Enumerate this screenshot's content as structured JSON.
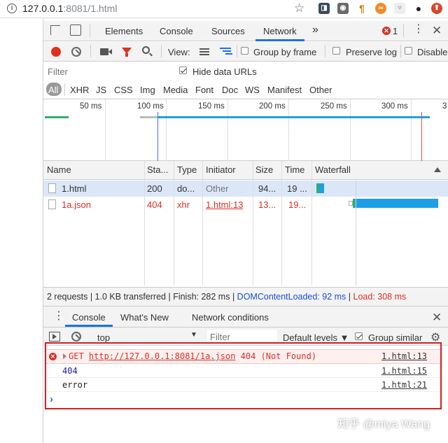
{
  "browser": {
    "url_host": "127.0.0.1",
    "url_rest": ":8081/1.html",
    "info_icon": "info-icon",
    "extensions": [
      "ext-1",
      "ext-2",
      "ext-3",
      "ext-4",
      "ext-5",
      "ext-6",
      "github-icon",
      "ext-8"
    ]
  },
  "devtools": {
    "tabs": [
      "Elements",
      "Console",
      "Sources",
      "Network"
    ],
    "more": "»",
    "error_count": "1",
    "active_tab": "Network",
    "toolbar": {
      "view_label": "View:",
      "group_by_frame": "Group by frame",
      "preserve_log": "Preserve log",
      "disable_cache": "Disable"
    },
    "filter": {
      "placeholder": "Filter",
      "hide_data_urls": "Hide data URLs"
    },
    "types": [
      "All",
      "XHR",
      "JS",
      "CSS",
      "Img",
      "Media",
      "Font",
      "Doc",
      "WS",
      "Manifest",
      "Other"
    ],
    "overview_ticks": [
      "50 ms",
      "100 ms",
      "150 ms",
      "200 ms",
      "250 ms",
      "300 ms",
      "3"
    ],
    "table": {
      "headers": [
        "Name",
        "Sta...",
        "Type",
        "Initiator",
        "Size",
        "Time",
        "Waterfall"
      ],
      "rows": [
        {
          "name": "1.html",
          "status": "200",
          "type": "do...",
          "initiator": "Other",
          "size": "94...",
          "time": "19 ...",
          "error": false
        },
        {
          "name": "1a.json",
          "status": "404",
          "type": "xhr",
          "initiator": "1.html:13",
          "size": "13...",
          "time": "19...",
          "error": true
        }
      ]
    },
    "status": {
      "summary": "2 requests | 1.0 KB transferred | Finish: 282 ms | ",
      "dcl": "DOMContentLoaded: 92 ms",
      "sep": " | ",
      "load": "Load: 308 ms"
    },
    "drawer": {
      "tabs": [
        "Console",
        "What's New",
        "Network conditions"
      ],
      "context": "top",
      "filter_placeholder": "Filter",
      "levels": "Default levels ▼",
      "group_similar": "Group similar"
    },
    "console": [
      {
        "kind": "error",
        "method": "GET",
        "url": "http://127.0.0.1:8081/1a.json",
        "status": "404 (Not Found)",
        "source": "1.html:13"
      },
      {
        "kind": "log",
        "text": "404",
        "source": "1.html:15"
      },
      {
        "kind": "log",
        "text": "error",
        "source": "1.html:21"
      }
    ],
    "prompt": "›"
  },
  "watermark": "知乎 @miya Wang",
  "colors": {
    "accent": "#1a73e8",
    "error": "#d93025",
    "highlight": "#d81e1e",
    "waterfall": "#1f9ee8"
  }
}
